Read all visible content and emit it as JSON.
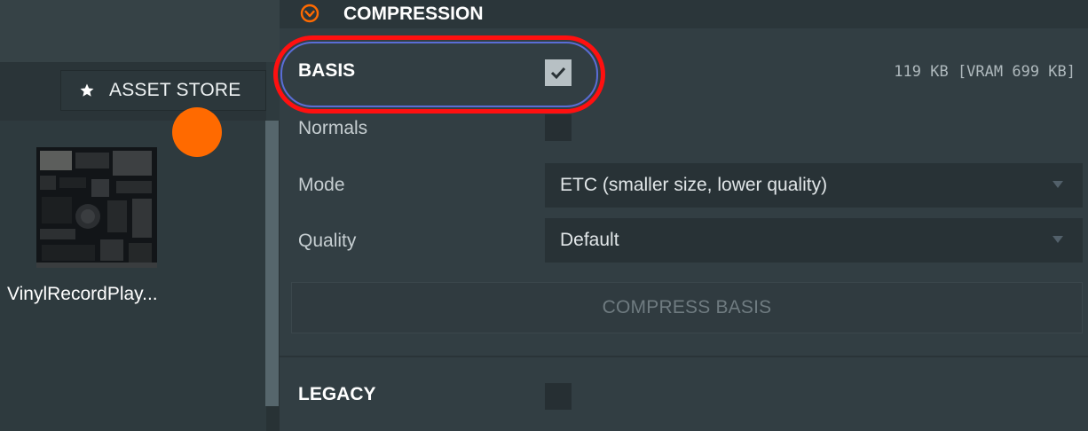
{
  "asset_panel": {
    "asset_store_label": "ASSET STORE",
    "asset_name": "VinylRecordPlay..."
  },
  "compression": {
    "section_title": "COMPRESSION",
    "basis": {
      "label": "BASIS",
      "checked": true,
      "size_readout": "119 KB [VRAM 699 KB]"
    },
    "normals": {
      "label": "Normals",
      "checked": false
    },
    "mode": {
      "label": "Mode",
      "value": "ETC (smaller size, lower quality)"
    },
    "quality": {
      "label": "Quality",
      "value": "Default"
    },
    "compress_button_label": "COMPRESS BASIS",
    "legacy": {
      "label": "LEGACY",
      "checked": false
    }
  },
  "colors": {
    "accent_orange": "#ff6a00",
    "highlight_red": "#ff1010",
    "highlight_blue": "#5a6dd6"
  },
  "icons": {
    "asset_store": "star-icon",
    "section_toggle": "collapse-circle-icon",
    "checkmark": "checkmark-icon",
    "dropdown": "triangle-down-icon"
  }
}
